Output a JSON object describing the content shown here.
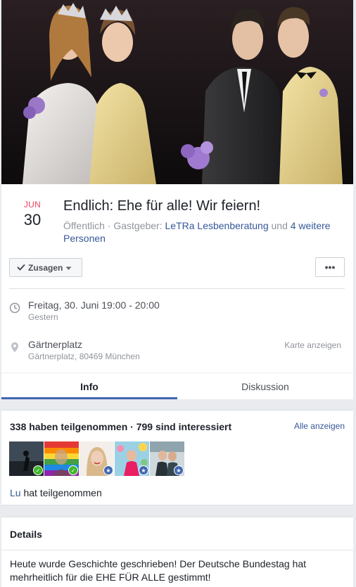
{
  "event": {
    "month": "JUN",
    "day": "30",
    "title": "Endlich: Ehe für alle! Wir feiern!",
    "visibility": "Öffentlich",
    "host_prefix": "Gastgeber:",
    "host_name": "LeTRa Lesbenberatung",
    "host_joiner": "und",
    "host_more": "4 weitere Personen"
  },
  "actions": {
    "rsvp_label": "Zusagen",
    "more_label": "•••"
  },
  "time": {
    "main": "Freitag, 30. Juni 19:00 - 20:00",
    "sub": "Gestern"
  },
  "location": {
    "name": "Gärtnerplatz",
    "address": "Gärtnerplatz, 80469 München",
    "map_link": "Karte anzeigen"
  },
  "tabs": [
    {
      "label": "Info",
      "active": true
    },
    {
      "label": "Diskussion",
      "active": false
    }
  ],
  "attendance": {
    "summary": "338 haben teilgenommen · 799 sind interessiert",
    "see_all": "Alle anzeigen",
    "avatars": [
      {
        "badge": "check",
        "color": "#42b72a"
      },
      {
        "badge": "check",
        "color": "#42b72a"
      },
      {
        "badge": "star",
        "color": "#4267b2"
      },
      {
        "badge": "star",
        "color": "#4267b2"
      },
      {
        "badge": "star",
        "color": "#4267b2"
      }
    ],
    "person": "Lu",
    "person_suffix": "hat teilgenommen"
  },
  "details": {
    "title": "Details",
    "text": "Heute wurde Geschichte geschrieben! Der Deutsche Bundestag hat mehrheitlich für die EHE FÜR ALLE gestimmt!"
  },
  "colors": {
    "accent": "#4267b2",
    "link": "#365899",
    "month": "#f3425f"
  }
}
